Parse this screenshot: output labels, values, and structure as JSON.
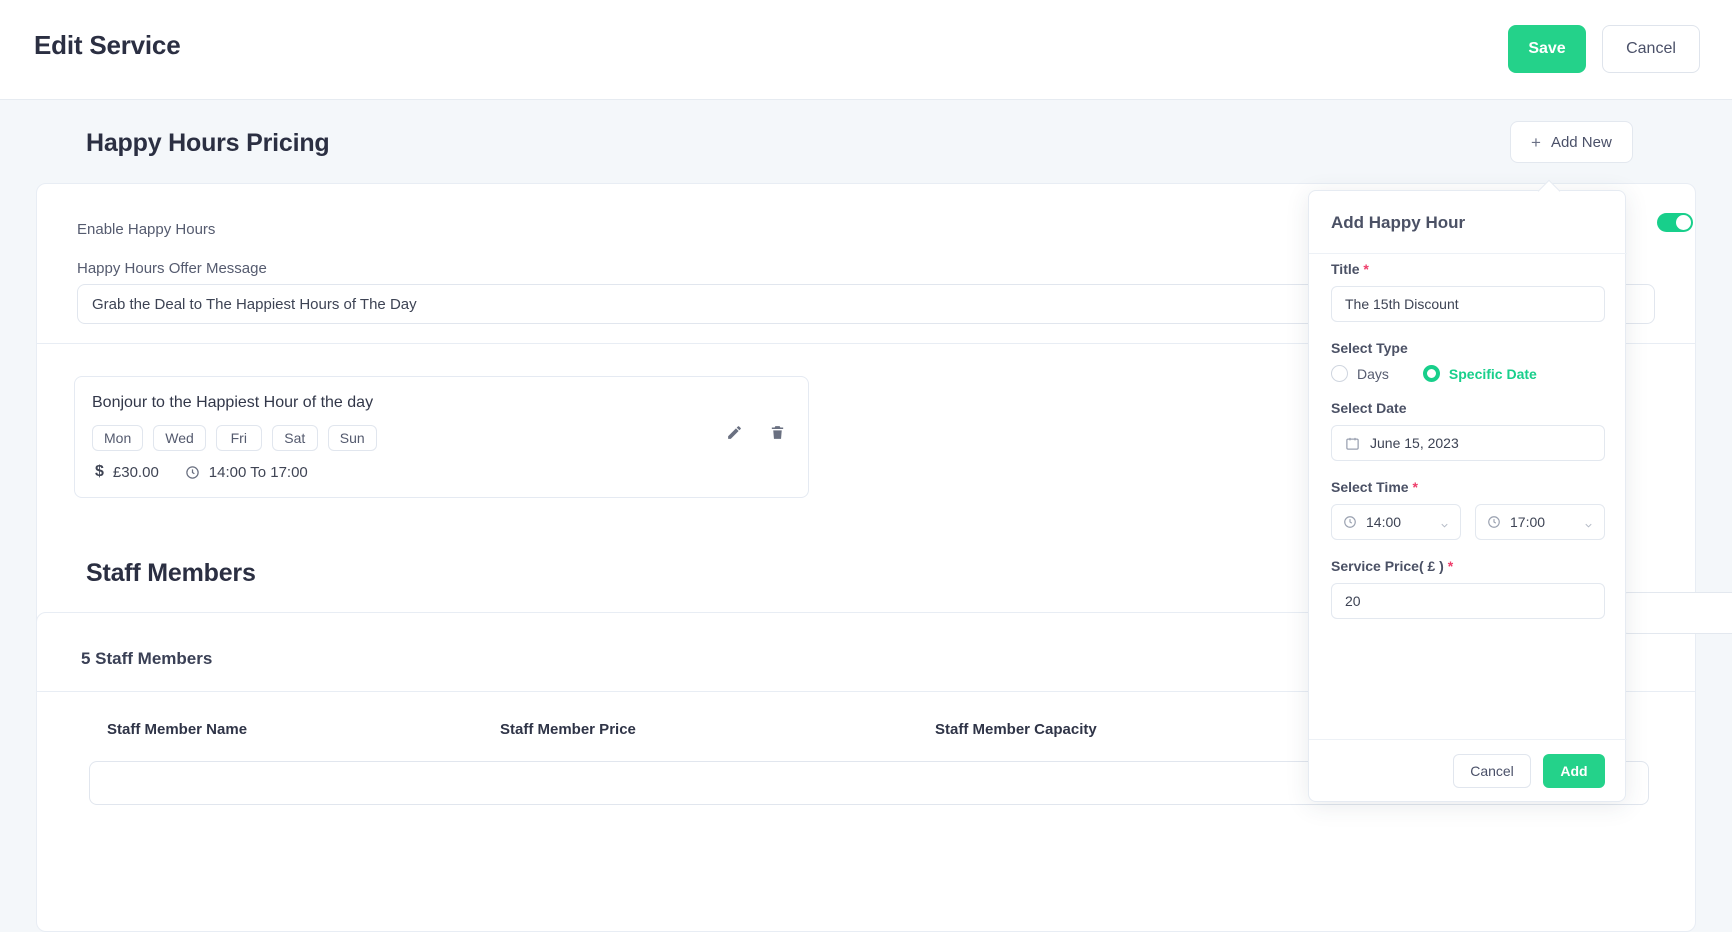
{
  "header": {
    "title": "Edit Service",
    "save_label": "Save",
    "cancel_label": "Cancel"
  },
  "happy_hours_section": {
    "title": "Happy Hours Pricing",
    "add_new_label": "Add New",
    "add_new_icon": "plus-icon",
    "enable_label": "Enable Happy Hours",
    "enable_toggle_state": "on",
    "offer_message_label": "Happy Hours Offer Message",
    "offer_message_value": "Grab the Deal to The Happiest Hours of The Day",
    "entry": {
      "title": "Bonjour to the Happiest Hour of the day",
      "days": [
        "Mon",
        "Wed",
        "Fri",
        "Sat",
        "Sun"
      ],
      "price_icon": "dollar-icon",
      "price": "£30.00",
      "time_icon": "clock-icon",
      "time_range": "14:00 To 17:00",
      "edit_icon": "pencil-icon",
      "delete_icon": "trash-icon"
    }
  },
  "staff_section": {
    "title": "Staff Members",
    "count_label": "5 Staff Members",
    "columns": [
      "Staff Member Name",
      "Staff Member Price",
      "Staff Member Capacity"
    ]
  },
  "popover": {
    "title": "Add Happy Hour",
    "title_field": {
      "label": "Title",
      "required": "*",
      "value": "The 15th Discount"
    },
    "select_type": {
      "label": "Select Type",
      "options": [
        "Days",
        "Specific Date"
      ],
      "selected": "Specific Date"
    },
    "select_date": {
      "label": "Select Date",
      "icon": "calendar-icon",
      "value": "June 15, 2023"
    },
    "select_time": {
      "label": "Select Time",
      "required": "*",
      "icon": "clock-icon",
      "from": "14:00",
      "to": "17:00"
    },
    "service_price": {
      "label": "Service Price( £ )",
      "required": "*",
      "value": "20"
    },
    "cancel_label": "Cancel",
    "add_label": "Add"
  },
  "colors": {
    "accent_green": "#24d28a",
    "toggle_green": "#18cf8b",
    "required_red": "#ee3d6a",
    "page_bg": "#f4f7fa",
    "text_dark": "#2b2f42"
  }
}
